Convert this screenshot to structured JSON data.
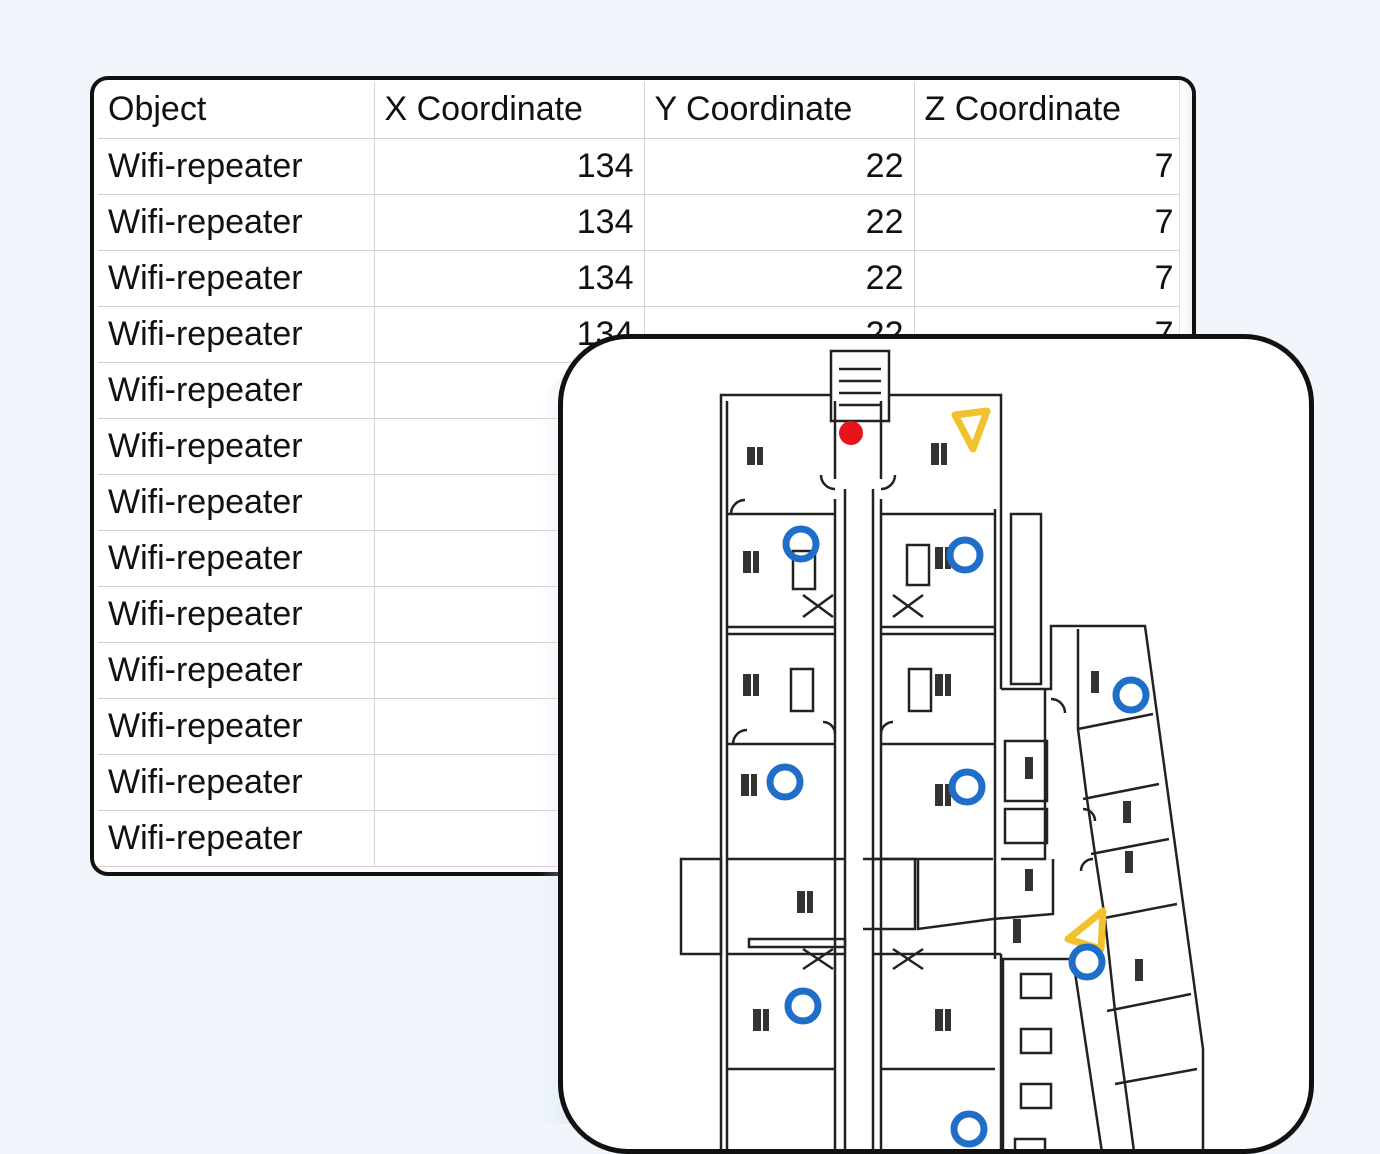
{
  "sheet": {
    "headers": [
      "Object",
      "X Coordinate",
      "Y Coordinate",
      "Z Coordinate"
    ],
    "rows": [
      {
        "object": "Wifi-repeater",
        "x": "134",
        "y": "22",
        "z": "7"
      },
      {
        "object": "Wifi-repeater",
        "x": "134",
        "y": "22",
        "z": "7"
      },
      {
        "object": "Wifi-repeater",
        "x": "134",
        "y": "22",
        "z": "7"
      },
      {
        "object": "Wifi-repeater",
        "x": "134",
        "y": "22",
        "z": "7"
      },
      {
        "object": "Wifi-repeater"
      },
      {
        "object": "Wifi-repeater"
      },
      {
        "object": "Wifi-repeater"
      },
      {
        "object": "Wifi-repeater"
      },
      {
        "object": "Wifi-repeater"
      },
      {
        "object": "Wifi-repeater"
      },
      {
        "object": "Wifi-repeater"
      },
      {
        "object": "Wifi-repeater"
      },
      {
        "object": "Wifi-repeater"
      }
    ]
  },
  "floorplan": {
    "marker_colors": {
      "repeater": "#1f6fc9",
      "access_point": "#f2c12e",
      "origin": "#e8141c"
    },
    "marker_icons": {
      "repeater": "blue-circle-icon",
      "access_point": "yellow-triangle-icon",
      "origin": "red-dot-icon"
    }
  }
}
